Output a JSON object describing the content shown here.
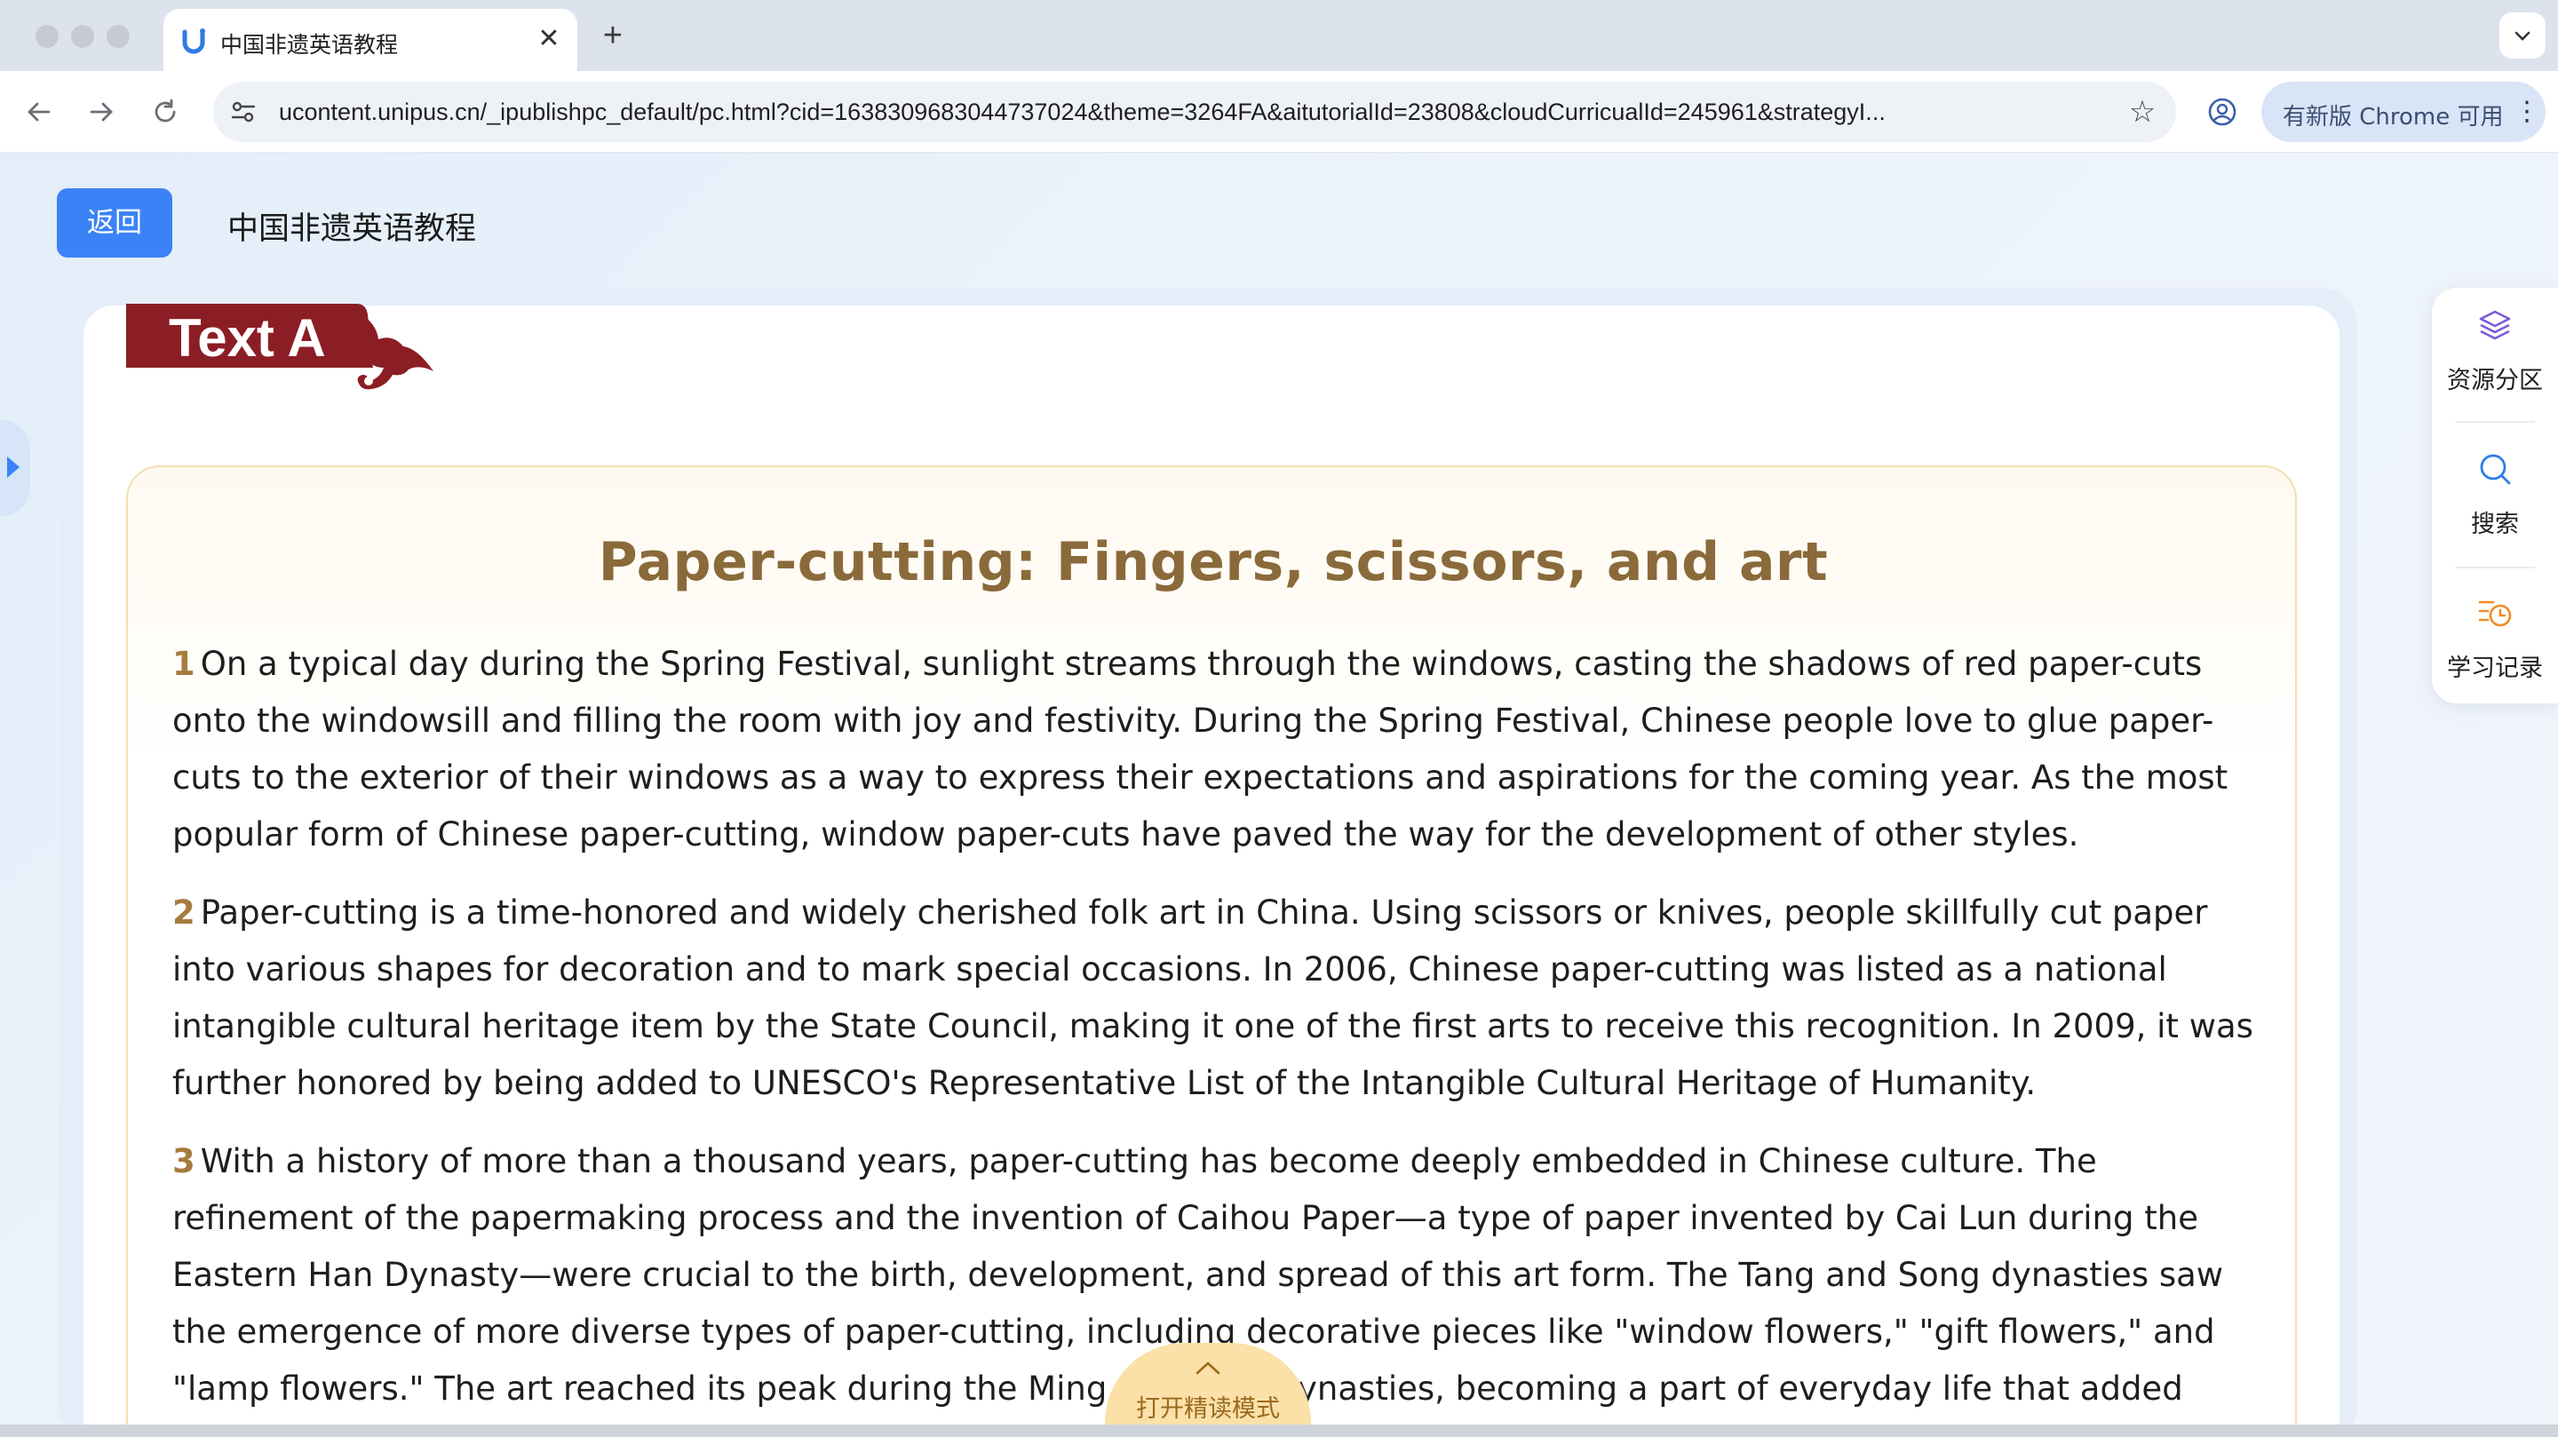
{
  "browser": {
    "tab_title": "中国非遗英语教程",
    "url": "ucontent.unipus.cn/_ipublishpc_default/pc.html?cid=1638309683044737024&theme=3264FA&aitutorialId=23808&cloudCurricualId=245961&strategyI...",
    "update_label": "有新版 Chrome 可用",
    "new_tab_label": "+",
    "close_label": "✕"
  },
  "header": {
    "back_label": "返回",
    "course_title": "中国非遗英语教程"
  },
  "banner": {
    "label": "Text A"
  },
  "article": {
    "title": "Paper-cutting: Fingers, scissors, and art",
    "paragraphs": [
      {
        "num": "1",
        "text": "On a typical day during the Spring Festival, sunlight streams through the windows, casting the shadows of red paper-cuts onto the windowsill and filling the room with joy and festivity. During the Spring Festival, Chinese people love to glue paper-cuts to the exterior of their windows as a way to express their expectations and aspirations for the coming year. As the most popular form of Chinese paper-cutting, window paper-cuts have paved the way for the development of other styles."
      },
      {
        "num": "2",
        "text": "Paper-cutting is a time-honored and widely cherished folk art in China. Using scissors or knives, people skillfully cut paper into various shapes for decoration and to mark special occasions. In 2006, Chinese paper-cutting was listed as a national intangible cultural heritage item by the State Council, making it one of the first arts to receive this recognition. In 2009, it was further honored by being added to UNESCO's Representative List of the Intangible Cultural Heritage of Humanity."
      },
      {
        "num": "3",
        "text": "With a history of more than a thousand years, paper-cutting has become deeply embedded in Chinese culture. The refinement of the papermaking process and the invention of Caihou Paper—a type of paper invented by Cai Lun during the Eastern Han Dynasty—were crucial to the birth, development, and spread of this art form. The Tang and Song dynasties saw the emergence of more diverse types of paper-cutting, including decorative pieces like \"window flowers,\" \"gift flowers,\" and \"lamp flowers.\" The art reached its peak during the Ming and Qing dynasties, becoming a part of everyday life that added striking decorative appeal."
      }
    ]
  },
  "read_mode": {
    "label": "打开精读模式"
  },
  "rail": {
    "resources_label": "资源分区",
    "search_label": "搜索",
    "records_label": "学习记录"
  },
  "colors": {
    "primary": "#3b82f6",
    "banner_red": "#8b1e24",
    "title_brown": "#8a6a3a",
    "para_num": "#a67c3d",
    "resources_icon": "#7b5cd6",
    "search_icon": "#2f7be6",
    "records_icon": "#f08a24"
  }
}
